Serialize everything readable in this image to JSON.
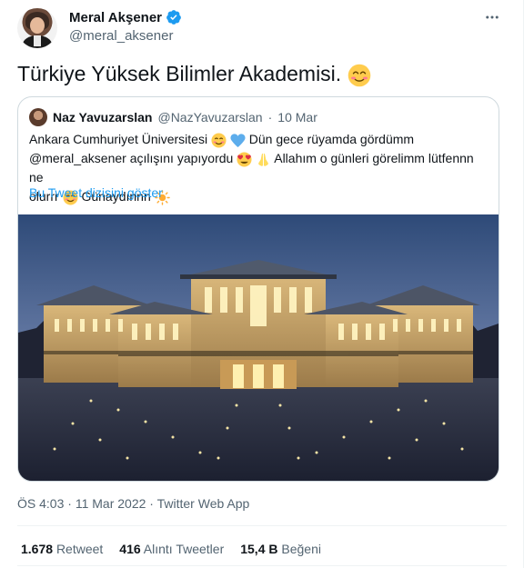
{
  "author": {
    "name": "Meral Akşener",
    "handle": "@meral_aksener",
    "avatar_icon": "profile-photo",
    "verified_icon": "verified-badge-icon"
  },
  "more_icon": "more-horizontal-icon",
  "tweet": {
    "text": "Türkiye Yüksek Bilimler Akademisi.",
    "emoji_icon": "smiling-face-with-smiling-eyes-emoji"
  },
  "quote": {
    "name": "Naz Yavuzarslan",
    "handle": "@NazYavuzarslan",
    "separator": "·",
    "date": "10 Mar",
    "line1_a": "Ankara Cumhuriyet Üniversitesi",
    "line1_b": "Dün gece rüyamda gördümm",
    "line2_a": "@meral_aksener açılışını yapıyordu",
    "line2_b": "Allahım o günleri görelimm lütfennn ne",
    "line3_a": "olurrr",
    "line3_b": "Günaydınnn",
    "show_thread": "Bu Tweet dizisini göster",
    "image": "palace-at-night-photo"
  },
  "meta": {
    "time": "ÖS 4:03",
    "date": "11 Mar 2022",
    "client": "Twitter Web App",
    "dot": "·"
  },
  "stats": [
    {
      "value": "1.678",
      "label": "Retweet"
    },
    {
      "value": "416",
      "label": "Alıntı Tweetler"
    },
    {
      "value": "15,4 B",
      "label": "Beğeni"
    }
  ],
  "colors": {
    "text": "#0f1419",
    "secondary": "#536471",
    "link": "#1d9bf0",
    "border": "#cfd9de",
    "divider": "#eff3f4"
  }
}
